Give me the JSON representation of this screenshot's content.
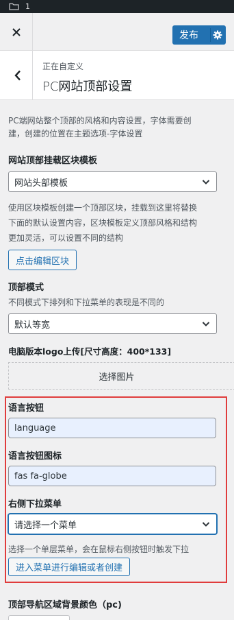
{
  "topbar": {
    "count": "1"
  },
  "header": {
    "publish_label": "发布"
  },
  "section": {
    "customizing": "正在自定义",
    "title": "PC网站顶部设置"
  },
  "intro": {
    "line1": "PC端网站整个顶部的风格和内容设置，字体需要创",
    "line2": "建，创建的位置在主题选项-字体设置"
  },
  "header_template": {
    "title": "网站顶部挂载区块模板",
    "selected": "网站头部模板",
    "desc1": "使用区块模板创建一个顶部区块，挂载到这里将替换",
    "desc2": "下面的默认设置内容，区块模板定义顶部风格和结构",
    "desc3": "更加灵活，可以设置不同的结构",
    "button": "点击编辑区块"
  },
  "top_mode": {
    "title": "顶部模式",
    "desc": "不同模式下排列和下拉菜单的表现是不同的",
    "selected": "默认等宽"
  },
  "logo_upload": {
    "title": "电脑版本logo上传[尺寸高度：400*133]",
    "button": "选择图片"
  },
  "language_button": {
    "title": "语言按钮",
    "value": "language"
  },
  "language_icon": {
    "title": "语言按钮图标",
    "value": "fas fa-globe"
  },
  "right_menu": {
    "title": "右侧下拉菜单",
    "selected": "请选择一个菜单",
    "desc": "选择一个单层菜单，会在鼠标右侧按钮时触发下拉",
    "button": "进入菜单进行编辑或者创建"
  },
  "nav_bg": {
    "title": "顶部导航区域背景颜色（pc)"
  },
  "colors": {
    "accent": "#2271b1",
    "highlight": "#e03c3c",
    "dark": "#1d2327"
  }
}
